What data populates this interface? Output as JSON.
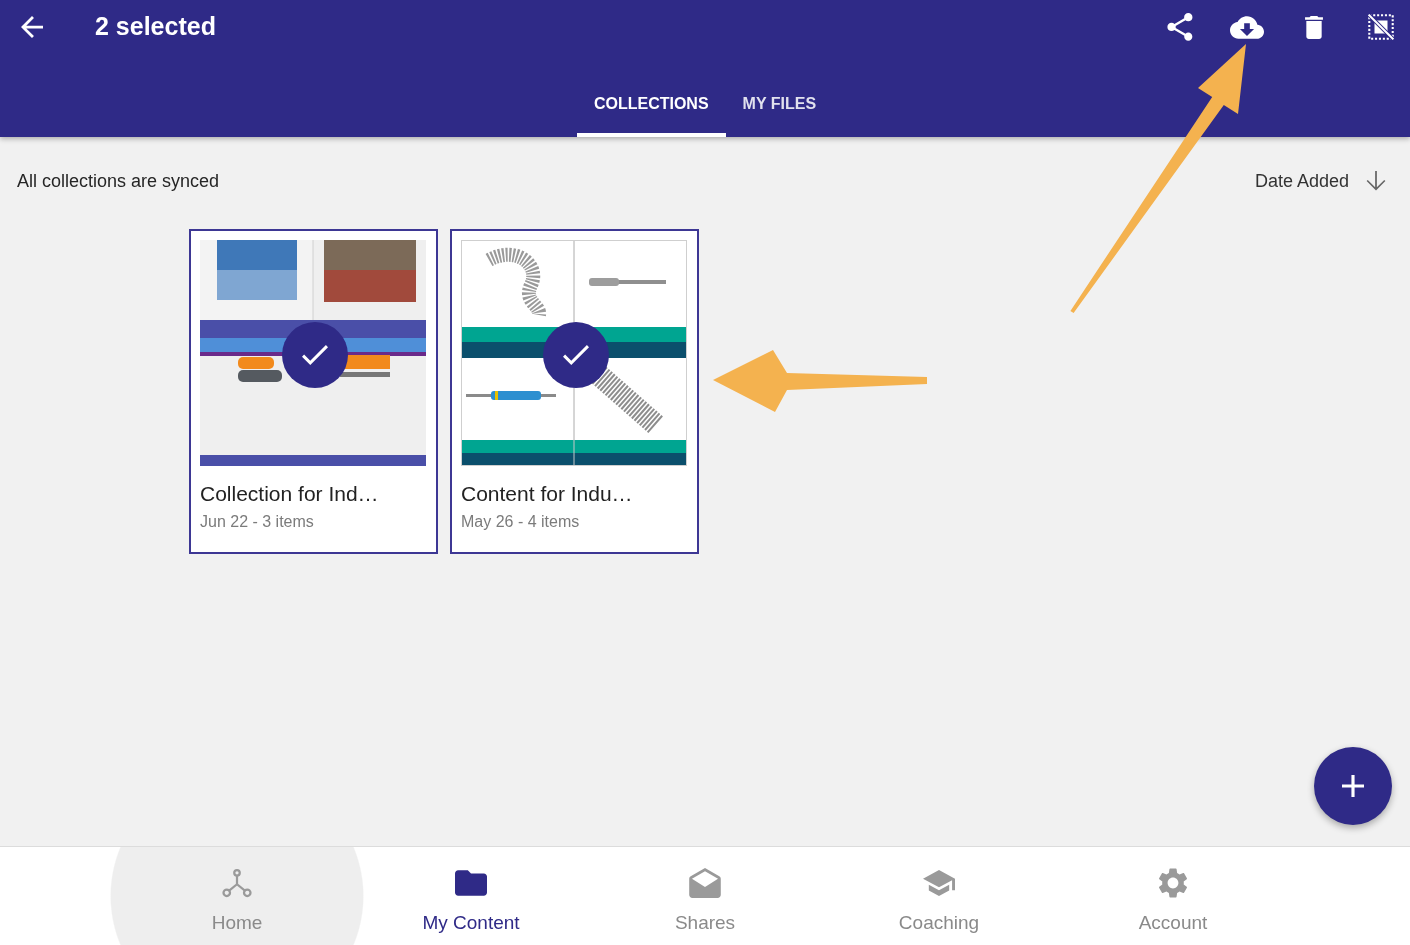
{
  "app_bar": {
    "title": "2 selected",
    "tabs": [
      {
        "label": "COLLECTIONS",
        "selected": true
      },
      {
        "label": "MY FILES",
        "selected": false
      }
    ]
  },
  "sync_status": "All collections are synced",
  "sort": {
    "label": "Date Added"
  },
  "collections": [
    {
      "title": "Collection for Ind…",
      "meta": "Jun 22 - 3 items",
      "selected": true
    },
    {
      "title": "Content for Indu…",
      "meta": "May 26 - 4 items",
      "selected": true
    }
  ],
  "bottom_nav": [
    {
      "label": "Home",
      "selected": false,
      "pressed": true
    },
    {
      "label": "My Content",
      "selected": true,
      "pressed": false
    },
    {
      "label": "Shares",
      "selected": false,
      "pressed": false
    },
    {
      "label": "Coaching",
      "selected": false,
      "pressed": false
    },
    {
      "label": "Account",
      "selected": false,
      "pressed": false
    }
  ]
}
